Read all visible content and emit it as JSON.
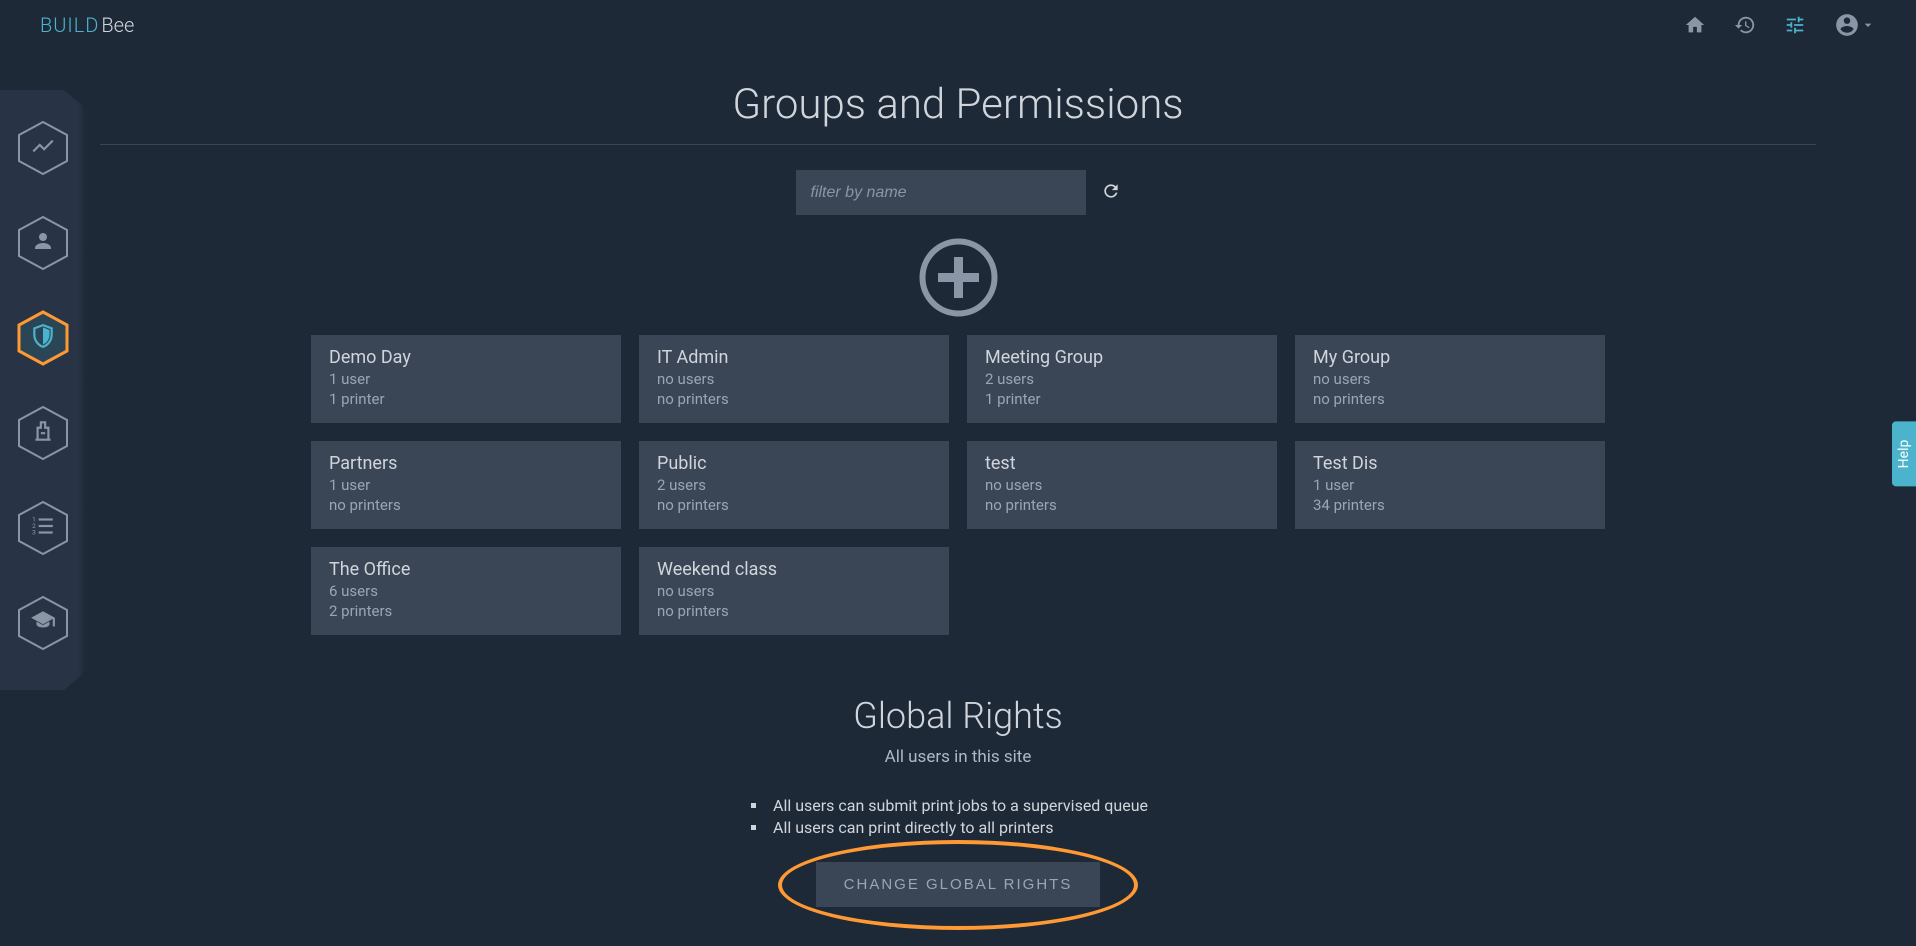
{
  "logo": {
    "part1": "BUILD",
    "part2": "Bee"
  },
  "page_title": "Groups and Permissions",
  "filter": {
    "placeholder": "filter by name"
  },
  "groups": [
    {
      "name": "Demo Day",
      "users": "1 user",
      "printers": "1 printer"
    },
    {
      "name": "IT Admin",
      "users": "no users",
      "printers": "no printers"
    },
    {
      "name": "Meeting Group",
      "users": "2 users",
      "printers": "1 printer"
    },
    {
      "name": "My Group",
      "users": "no users",
      "printers": "no printers"
    },
    {
      "name": "Partners",
      "users": "1 user",
      "printers": "no printers"
    },
    {
      "name": "Public",
      "users": "2 users",
      "printers": "no printers"
    },
    {
      "name": "test",
      "users": "no users",
      "printers": "no printers"
    },
    {
      "name": "Test Dis",
      "users": "1 user",
      "printers": "34 printers"
    },
    {
      "name": "The Office",
      "users": "6 users",
      "printers": "2 printers"
    },
    {
      "name": "Weekend class",
      "users": "no users",
      "printers": "no printers"
    }
  ],
  "global_rights": {
    "title": "Global Rights",
    "subtitle": "All users in this site",
    "rights": [
      "All users can submit print jobs to a supervised queue",
      "All users can print directly to all printers"
    ],
    "button": "CHANGE GLOBAL RIGHTS"
  },
  "help_label": "Help"
}
